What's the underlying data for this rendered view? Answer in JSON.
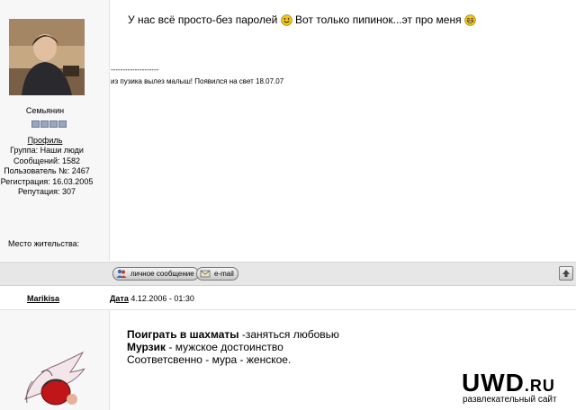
{
  "post1": {
    "message_part1": "У нас всё просто-без паролей",
    "message_part2": "Вот только пипинок...эт про меня",
    "signature_divider": "--------------------",
    "signature_text": "из пузика вылез малыш! Появился на свет 18.07.07",
    "author": {
      "rank": "Семьянин",
      "profile_link": "Профиль",
      "group": "Группа: Наши люди",
      "posts": "Сообщений: 1582",
      "user_no": "Пользователь №: 2467",
      "registered": "Регистрация: 16.03.2005",
      "reputation": "Репутация: 307",
      "location": "Место жительства:"
    },
    "actions": {
      "pm": "личное сообщение",
      "email": "e-mail"
    }
  },
  "post2": {
    "author": "Marikisa",
    "date_label": "Дата",
    "date_value": "4.12.2006 - 01:30",
    "lines": [
      {
        "bold": "Поиграть в шахматы",
        "rest": " -заняться любовью"
      },
      {
        "bold": "Мурзик",
        "rest": " - мужское достоинство"
      },
      {
        "bold": "",
        "rest": "Соответсвенно - мура - женское."
      }
    ]
  },
  "watermark": {
    "main": "UWD",
    "suffix": ".RU",
    "subtitle": "развлекательный сайт"
  },
  "colors": {
    "profile_bg": "#f7f7f7",
    "actionbar_bg": "#e7e7e7",
    "smiley": "#f3c61d"
  }
}
